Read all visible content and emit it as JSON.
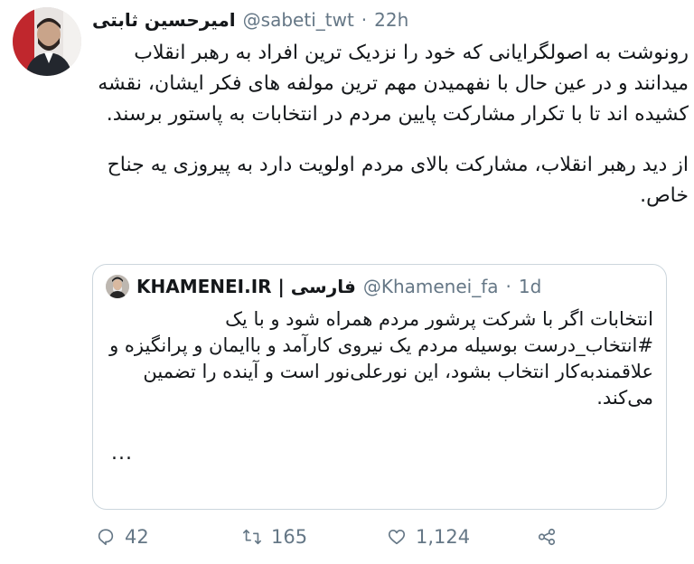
{
  "tweet": {
    "author_name": "امیرحسین ثابتی",
    "handle": "@sabeti_twt",
    "separator": "·",
    "time": "22h",
    "paragraphs": [
      "رونوشت به اصولگرایانی که خود را نزدیک ترین افراد به رهبر انقلاب میدانند و در عین حال با نفهمیدن مهم ترین مولفه های فکر ایشان، نقشه کشیده اند تا با تکرار مشارکت پایین مردم در انتخابات به پاستور برسند.",
      "از دید رهبر انقلاب، مشارکت بالای مردم اولویت دارد به پیروزی یه جناح خاص."
    ]
  },
  "quote": {
    "author_name": "KHAMENEI.IR | فارسی",
    "handle": "@Khamenei_fa",
    "separator": "·",
    "time": "1d",
    "text": "انتخابات اگر با شرکت پرشور مردم همراه شود و با یک #انتخاب_درست بوسیله مردم یک نیروی کارآمد و باایمان و پرانگیزه و علاقمندبه‌کار انتخاب بشود، این نورعلی‌نور است و آینده را تضمین می‌کند.",
    "ellipsis": "..."
  },
  "actions": {
    "reply": {
      "icon": "reply-icon",
      "count": "42"
    },
    "retweet": {
      "icon": "retweet-icon",
      "count": "165"
    },
    "like": {
      "icon": "heart-icon",
      "count": "1,124"
    },
    "share": {
      "icon": "share-icon"
    }
  },
  "colors": {
    "text": "#14171a",
    "secondary": "#657786",
    "border": "#ccd6dd"
  }
}
